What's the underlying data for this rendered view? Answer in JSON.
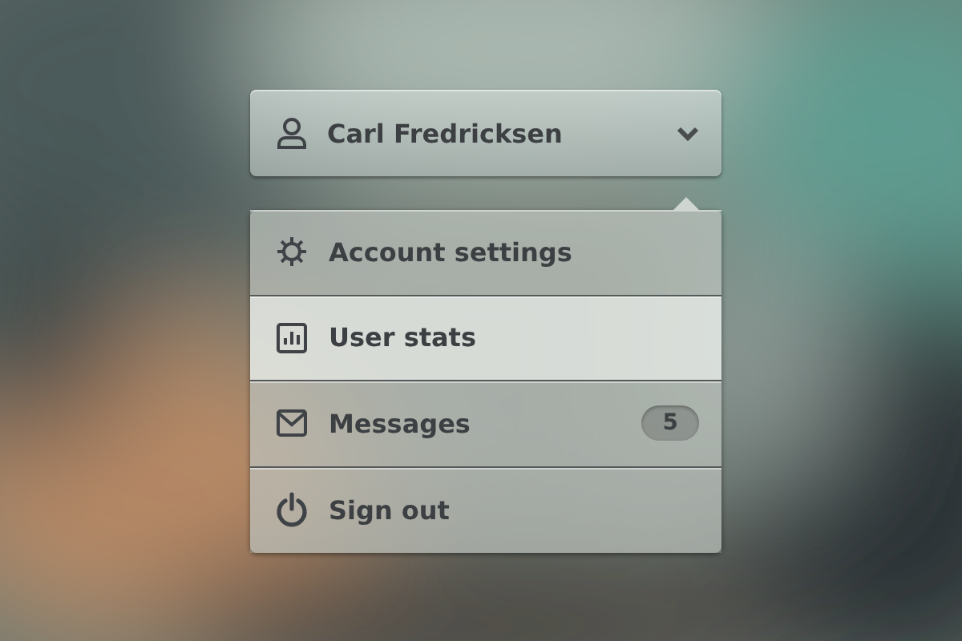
{
  "user_button": {
    "name": "Carl Fredricksen",
    "expanded": true
  },
  "menu": {
    "items": [
      {
        "kind": "settings",
        "label": "Account settings",
        "selected": false
      },
      {
        "kind": "stats",
        "label": "User stats",
        "selected": true
      },
      {
        "kind": "messages",
        "label": "Messages",
        "badge": "5",
        "selected": false
      },
      {
        "kind": "signout",
        "label": "Sign out",
        "selected": false
      }
    ]
  }
}
